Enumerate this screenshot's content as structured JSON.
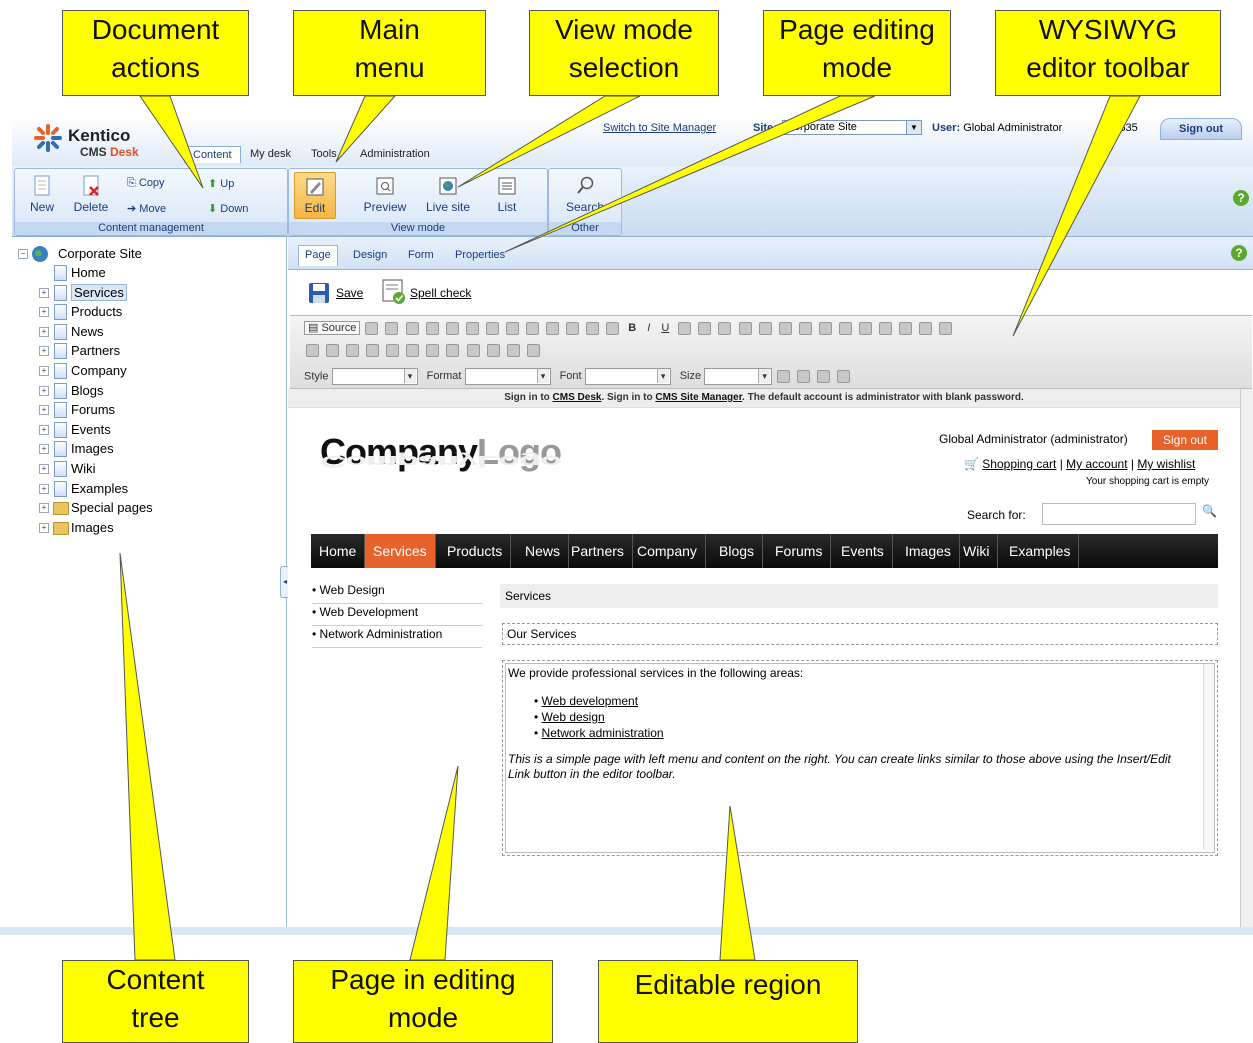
{
  "callouts": {
    "document_actions": [
      "Document",
      "actions"
    ],
    "main_menu": [
      "Main",
      "menu"
    ],
    "view_mode_selection": [
      "View mode",
      "selection"
    ],
    "page_editing_mode": [
      "Page editing",
      "mode"
    ],
    "wysiwyg_toolbar": [
      "WYSIWYG",
      "editor toolbar"
    ],
    "content_tree": [
      "Content",
      "tree"
    ],
    "page_in_editing_mode": [
      "Page in editing",
      "mode"
    ],
    "editable_region": [
      "Editable region"
    ]
  },
  "header": {
    "brand_top": "Kentico",
    "brand_cms": "CMS",
    "brand_desk": "Desk",
    "tabs": [
      "Content",
      "My desk",
      "Tools",
      "Administration"
    ],
    "switch_link": "Switch to Site Manager",
    "site_label": "Site:",
    "site_value": "Corporate Site",
    "user_label": "User:",
    "user_value": "Global Administrator",
    "user_trailing": "3635",
    "sign_out": "Sign out"
  },
  "ribbon": {
    "content_group": {
      "label": "Content management",
      "new": "New",
      "delete": "Delete",
      "copy": "Copy",
      "move": "Move",
      "up": "Up",
      "down": "Down"
    },
    "view_group": {
      "label": "View mode",
      "edit": "Edit",
      "preview": "Preview",
      "live_site": "Live site",
      "list": "List"
    },
    "other_group": {
      "label": "Other",
      "search": "Search"
    }
  },
  "tree": {
    "root": "Corporate Site",
    "items": [
      "Home",
      "Services",
      "Products",
      "News",
      "Partners",
      "Company",
      "Blogs",
      "Forums",
      "Events",
      "Images",
      "Wiki",
      "Examples",
      "Special pages",
      "Images"
    ],
    "selected": "Services"
  },
  "page_tabs": [
    "Page",
    "Design",
    "Form",
    "Properties"
  ],
  "savebar": {
    "save": "Save",
    "spell_check": "Spell check"
  },
  "editor_toolbar": {
    "source": "Source",
    "style_label": "Style",
    "format_label": "Format",
    "font_label": "Font",
    "size_label": "Size"
  },
  "info_strip": {
    "part1": "Sign in to",
    "link1": "CMS Desk",
    "part2": ". Sign in to",
    "link2": "CMS Site Manager",
    "part3": ". The default account is administrator with blank password."
  },
  "site_page": {
    "logo_dark": "Company",
    "logo_light": "Logo",
    "user_name": "Global Administrator (administrator)",
    "sign_out": "Sign out",
    "shopping_cart": "Shopping cart",
    "my_account": "My account",
    "my_wishlist": "My wishlist",
    "separator": "|",
    "cart_status": "Your shopping cart is empty",
    "search_for": "Search for:",
    "nav": [
      "Home",
      "Services",
      "Products",
      "News",
      "Partners",
      "Company",
      "Blogs",
      "Forums",
      "Events",
      "Images",
      "Wiki",
      "Examples"
    ],
    "nav_active": "Services",
    "left_menu": [
      "Web Design",
      "Web Development",
      "Network Administration"
    ],
    "section_title": "Services",
    "region_title": "Our Services",
    "region_intro": "We provide professional services in the following areas:",
    "region_links": [
      "Web development",
      "Web design",
      "Network administration"
    ],
    "region_note": "This is a simple page with left menu and content on the right. You can create links similar to those above using the Insert/Edit Link button in the editor toolbar."
  }
}
